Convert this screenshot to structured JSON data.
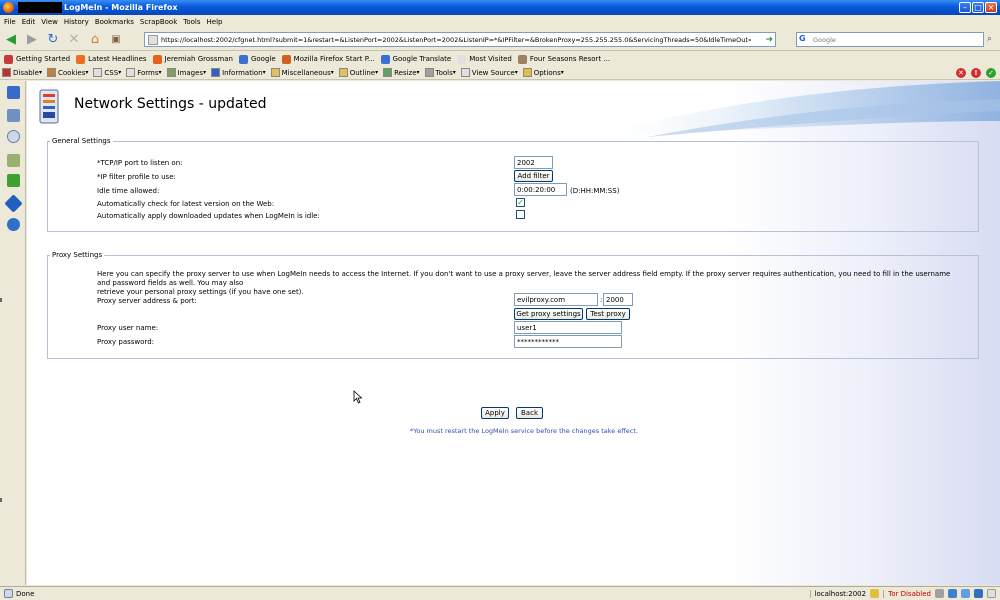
{
  "window": {
    "title": "LogMeIn - Mozilla Firefox"
  },
  "menu": [
    "File",
    "Edit",
    "View",
    "History",
    "Bookmarks",
    "ScrapBook",
    "Tools",
    "Help"
  ],
  "nav": {
    "url": "https://localhost:2002/cfgnet.html?submit=1&restart=&ListenPort=2002&ListenPort=2002&ListenIP=*&IPFilter=&BrokenProxy=255.255.255.0&ServicingThreads=50&IdleTimeOut=0%3A00%3A20%3A00",
    "search_placeholder": "Google"
  },
  "bookmarks": [
    {
      "label": "Getting Started",
      "color": "#c83a3a"
    },
    {
      "label": "Latest Headlines",
      "color": "#e87020"
    },
    {
      "label": "Jeremiah Grossman",
      "color": "#e86020"
    },
    {
      "label": "Google",
      "color": "#3a70d0"
    },
    {
      "label": "Mozilla Firefox Start P...",
      "color": "#d06020"
    },
    {
      "label": "Google Translate",
      "color": "#3a70d0"
    },
    {
      "label": "Most Visited",
      "color": "#e0e0e0"
    },
    {
      "label": "Four Seasons Resort ...",
      "color": "#a08060"
    }
  ],
  "devtools": [
    {
      "label": "Disable",
      "color": "#c03030"
    },
    {
      "label": "Cookies",
      "color": "#c08040"
    },
    {
      "label": "CSS",
      "color": "#e0e0e0"
    },
    {
      "label": "Forms",
      "color": "#e0e0e0"
    },
    {
      "label": "Images",
      "color": "#80a060"
    },
    {
      "label": "Information",
      "color": "#3060c0"
    },
    {
      "label": "Miscellaneous",
      "color": "#e0c060"
    },
    {
      "label": "Outline",
      "color": "#e0c060"
    },
    {
      "label": "Resize",
      "color": "#60a060"
    },
    {
      "label": "Tools",
      "color": "#a0a0a0"
    },
    {
      "label": "View Source",
      "color": "#e0e0e0"
    },
    {
      "label": "Options",
      "color": "#e0c040"
    }
  ],
  "page": {
    "title": "Network Settings - updated"
  },
  "general": {
    "legend": "General Settings",
    "tcp_label": "*TCP/IP port to listen on:",
    "tcp_value": "2002",
    "ipfilter_label": "*IP filter profile to use:",
    "add_filter": "Add filter",
    "idle_label": "Idle time allowed:",
    "idle_value": "0:00:20:00",
    "idle_hint": "(D:HH:MM:SS)",
    "check_label": "Automatically check for latest version on the Web:",
    "check_checked": true,
    "apply_label": "Automatically apply downloaded updates when LogMeIn is idle:",
    "apply_checked": false
  },
  "proxy": {
    "legend": "Proxy Settings",
    "desc_line1": "Here you can specify the proxy server to use when LogMeIn needs to access the Internet. If you don't want to use a proxy server, leave the server address field empty. If the proxy server requires authentication, you need to fill in the username and password fields as well. You may also",
    "desc_line2": "retrieve your personal proxy settings (if you have one set).",
    "address_label": "Proxy server address & port:",
    "address_value": "evilproxy.com",
    "port_sep": ":",
    "port_value": "2000",
    "get_btn": "Get proxy settings",
    "test_btn": "Test proxy",
    "user_label": "Proxy user name:",
    "user_value": "user1",
    "pass_label": "Proxy password:",
    "pass_value": "************"
  },
  "actions": {
    "apply": "Apply",
    "back": "Back",
    "note": "*You must restart the LogMeIn service before the changes take effect."
  },
  "status": {
    "text": "Done",
    "host": "localhost:2002",
    "tor": "Tor Disabled"
  }
}
